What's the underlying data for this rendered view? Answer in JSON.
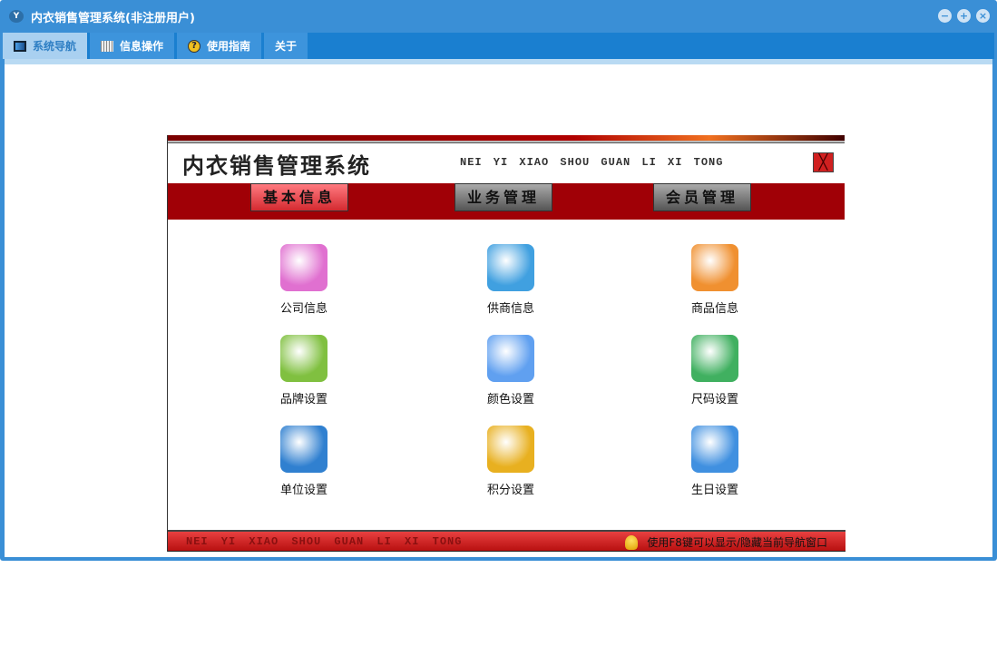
{
  "window": {
    "title": "内衣销售管理系统(非注册用户)",
    "controls": [
      "minimize",
      "maximize",
      "close"
    ]
  },
  "tabs": [
    {
      "label": "系统导航",
      "icon": "monitor-icon",
      "active": true
    },
    {
      "label": "信息操作",
      "icon": "grid-icon"
    },
    {
      "label": "使用指南",
      "icon": "help-icon"
    },
    {
      "label": "关于"
    }
  ],
  "panel": {
    "title": "内衣销售管理系统",
    "pinyin": "NEI YI XIAO SHOU GUAN LI XI TONG",
    "menu": [
      "基本信息",
      "业务管理",
      "会员管理"
    ],
    "items": [
      {
        "label": "公司信息",
        "icon": "building-icon",
        "color": "#e070d0"
      },
      {
        "label": "供商信息",
        "icon": "rainbow-icon",
        "color": "#40a0e0"
      },
      {
        "label": "商品信息",
        "icon": "boxes-icon",
        "color": "#f09030"
      },
      {
        "label": "品牌设置",
        "icon": "book-icon",
        "color": "#80c040"
      },
      {
        "label": "颜色设置",
        "icon": "butterfly-icon",
        "color": "#60a0f0"
      },
      {
        "label": "尺码设置",
        "icon": "folder-icon",
        "color": "#40b060"
      },
      {
        "label": "单位设置",
        "icon": "globe-pen-icon",
        "color": "#3080d0"
      },
      {
        "label": "积分设置",
        "icon": "cards-icon",
        "color": "#e8b020"
      },
      {
        "label": "生日设置",
        "icon": "bell-icon",
        "color": "#4090e0"
      }
    ],
    "footer_pinyin": "NEI YI XIAO SHOU GUAN LI XI TONG",
    "footer_tip": "使用F8键可以显示/隐藏当前导航窗口"
  }
}
